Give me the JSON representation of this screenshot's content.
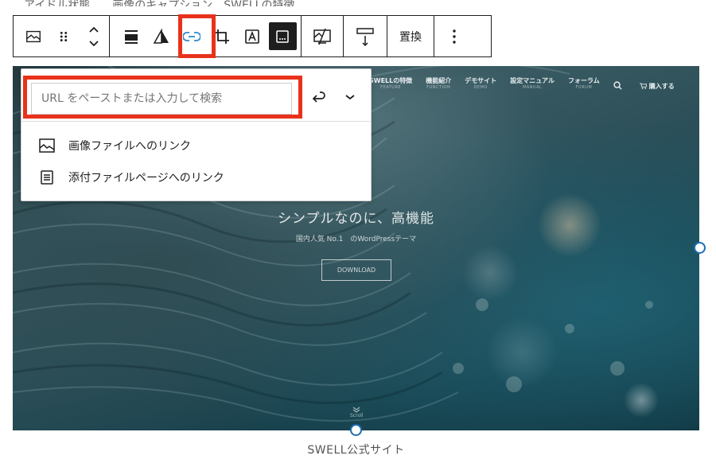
{
  "top_clip_text": "アイドル状態　　画像のキャプション　SWELLの特徴",
  "toolbar": {
    "image_icon": "image-icon",
    "drag_icon": "drag-handle-icon",
    "move_icon": "move-up-down-icon",
    "align_icon": "align-icon",
    "duotone_icon": "duotone-icon",
    "link_icon": "link-icon",
    "crop_icon": "crop-icon",
    "text_overlay_icon": "text-overlay-icon",
    "caption_icon": "caption-icon",
    "swap_icon": "swap-image-icon",
    "upload_icon": "upload-icon",
    "replace_label": "置換",
    "more_icon": "more-vertical-icon",
    "highlight_color": "#e8321b"
  },
  "site": {
    "nav": [
      {
        "main": "SWELLの特徴",
        "sub": "FEATURE"
      },
      {
        "main": "機能紹介",
        "sub": "FUNCTION"
      },
      {
        "main": "デモサイト",
        "sub": "DEMO"
      },
      {
        "main": "設定マニュアル",
        "sub": "MANUAL"
      },
      {
        "main": "フォーラム",
        "sub": "FORUM"
      }
    ],
    "cart_label": "購入する",
    "hero_title": "シンプルなのに、高機能",
    "hero_sub": "国内人気 No.1　のWordPressテーマ",
    "download_label": "DOWNLOAD",
    "scroll_label": "Scroll"
  },
  "link_popover": {
    "url_placeholder": "URL をペーストまたは入力して検索",
    "url_value": "",
    "submit_icon": "enter-icon",
    "options_icon": "chevron-down-icon",
    "suggestions": [
      {
        "label": "画像ファイルへのリンク",
        "icon": "image-icon"
      },
      {
        "label": "添付ファイルページへのリンク",
        "icon": "page-icon"
      }
    ]
  },
  "caption": "SWELL公式サイト",
  "colors": {
    "accent": "#1e6fb0",
    "link_active": "#2b8ad3",
    "toolbar_dark": "#1e1e1e"
  }
}
